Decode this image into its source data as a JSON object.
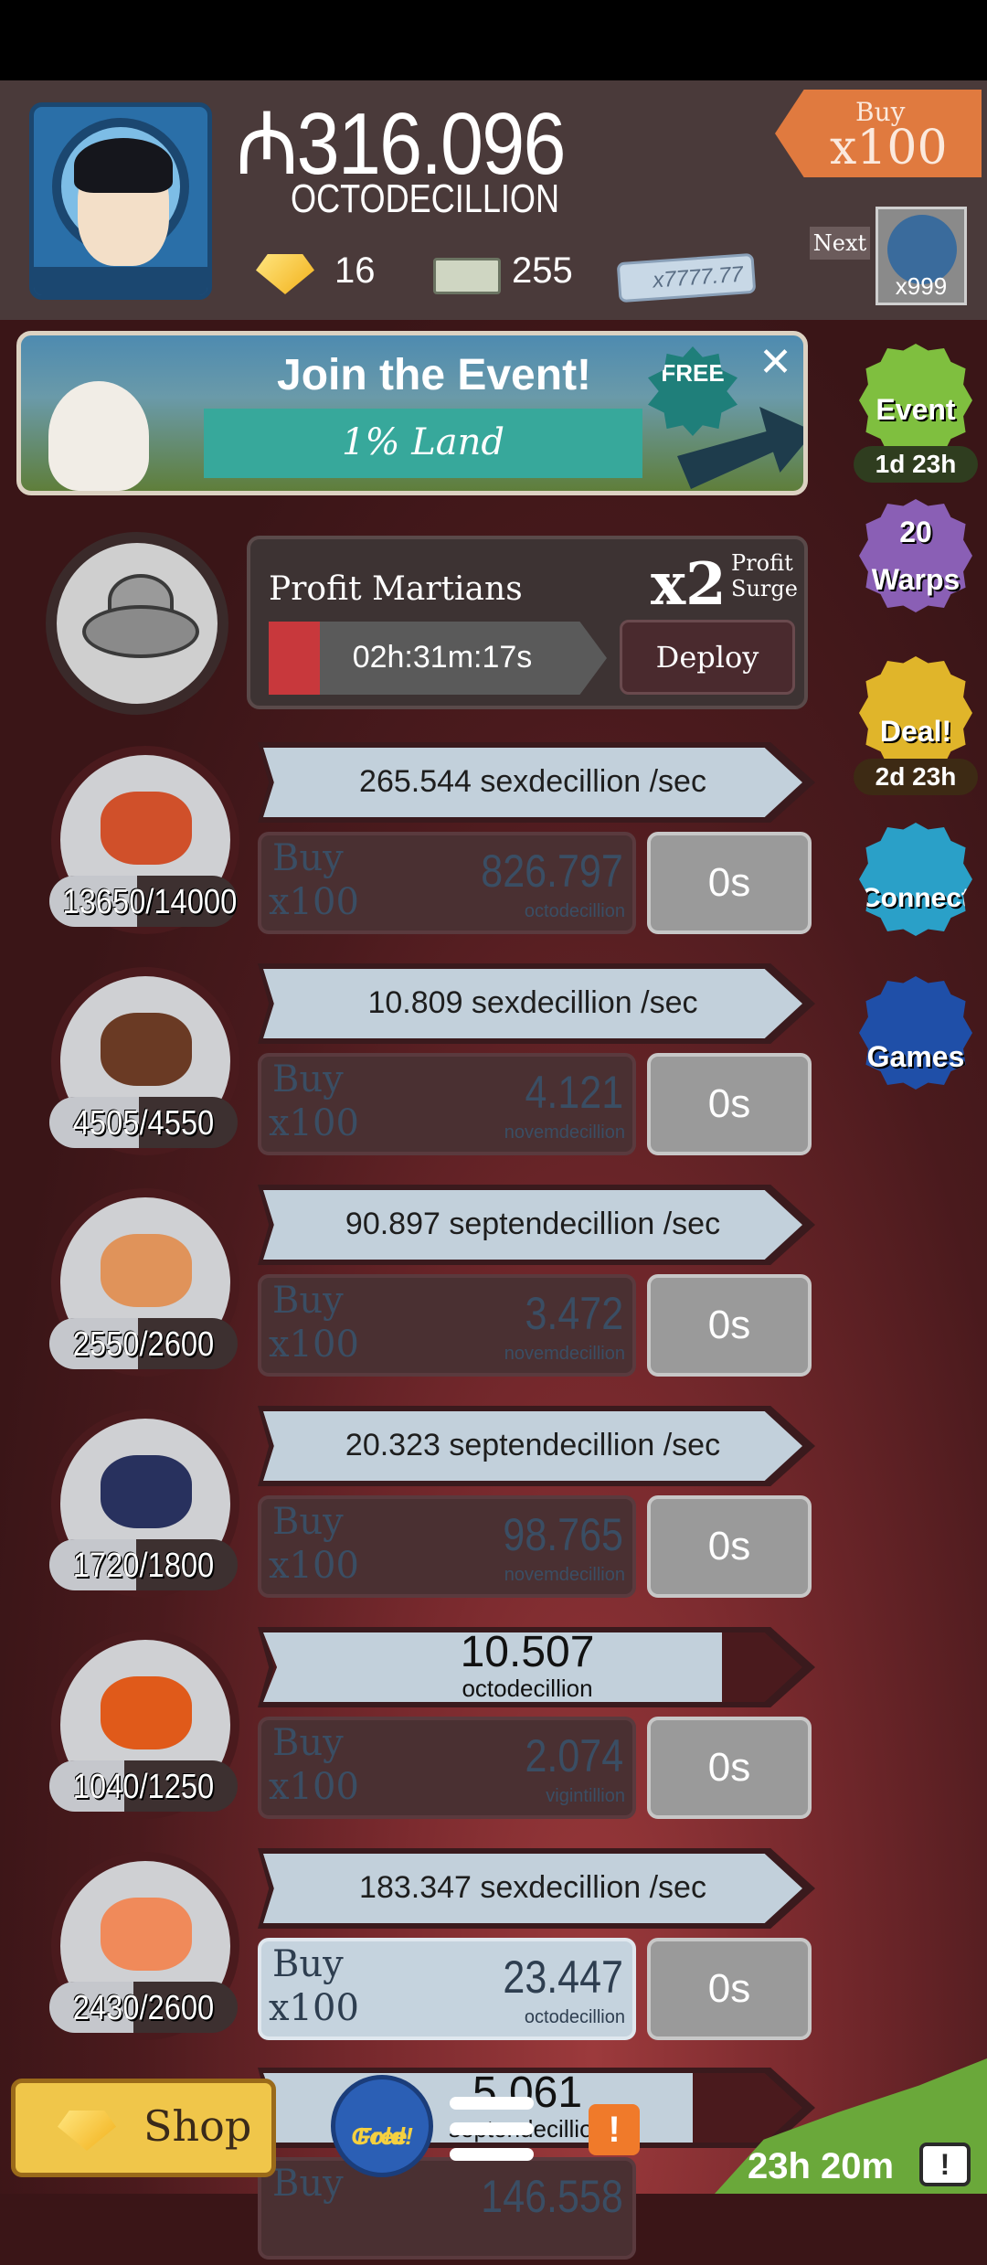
{
  "header": {
    "money_symbol": "₼",
    "money_value": "316.096",
    "money_unit": "OCTODECILLION",
    "gold_count": "16",
    "megabucks_count": "255",
    "megaticket_label": "x7777.77",
    "buy_tag": {
      "label": "Buy",
      "value": "x100"
    },
    "next": {
      "label": "Next",
      "value": "x999"
    }
  },
  "event_banner": {
    "title": "Join the Event!",
    "subtitle": "1% Land",
    "free_label": "FREE",
    "close_glyph": "✕"
  },
  "side_menu": [
    {
      "label": "Event",
      "timer": "1d 23h",
      "color": "#7fbf3f"
    },
    {
      "label": "Warps",
      "badge": "20",
      "color": "#8a5fb5"
    },
    {
      "label": "Deal!",
      "timer": "2d 23h",
      "color": "#e0b52a"
    },
    {
      "label": "Connect",
      "color": "#2aa0c8"
    },
    {
      "label": "Games",
      "color": "#1f4fa8"
    }
  ],
  "manager": {
    "name": "Profit Martians",
    "multiplier": "x2",
    "surge_label_1": "Profit",
    "surge_label_2": "Surge",
    "timer": "02h:31m:17s",
    "deploy_label": "Deploy",
    "progress": 0.12
  },
  "businesses": [
    {
      "owned": "13650/14000",
      "progress": 0.975,
      "rate": "265.544 sexdecillion /sec",
      "buy1": "Buy",
      "buy2": "x100",
      "cost": "826.797",
      "unit": "octodecillion",
      "time": "0s",
      "icon": "red-rocks-icon",
      "affordable": false
    },
    {
      "owned": "4505/4550",
      "progress": 0.99,
      "rate": "10.809 sexdecillion /sec",
      "buy1": "Buy",
      "buy2": "x100",
      "cost": "4.121",
      "unit": "novemdecillion",
      "time": "0s",
      "icon": "chocolate-bar-icon",
      "affordable": false
    },
    {
      "owned": "2550/2600",
      "progress": 0.98,
      "rate": "90.897 septendecillion /sec",
      "buy1": "Buy",
      "buy2": "x100",
      "cost": "3.472",
      "unit": "novemdecillion",
      "time": "0s",
      "icon": "human-head-icon",
      "affordable": false
    },
    {
      "owned": "1720/1800",
      "progress": 0.96,
      "rate": "20.323 septendecillion /sec",
      "buy1": "Buy",
      "buy2": "x100",
      "cost": "98.765",
      "unit": "novemdecillion",
      "time": "0s",
      "icon": "spotted-dome-icon",
      "affordable": false
    },
    {
      "owned": "1040/1250",
      "progress": 0.83,
      "rate_big": "10.507",
      "rate_small": "octodecillion",
      "rate_fill": 0.85,
      "buy1": "Buy",
      "buy2": "x100",
      "cost": "2.074",
      "unit": "vigintillion",
      "time": "0s",
      "icon": "sun-coin-icon",
      "affordable": false
    },
    {
      "owned": "2430/2600",
      "progress": 0.93,
      "rate": "183.347 sexdecillion /sec",
      "buy1": "Buy",
      "buy2": "x100",
      "cost": "23.447",
      "unit": "octodecillion",
      "time": "0s",
      "icon": "alien-queen-icon",
      "affordable": true
    }
  ],
  "partial_row": {
    "rate_big": "5.061",
    "rate_small": "septendecillion",
    "cost": "146.558",
    "buy1": "Buy"
  },
  "bottom": {
    "shop_label": "Shop",
    "free_gold_1": "Free",
    "free_gold_2": "Gold!",
    "alert": "!",
    "timer": "23h 20m",
    "tv_glyph": "!"
  }
}
